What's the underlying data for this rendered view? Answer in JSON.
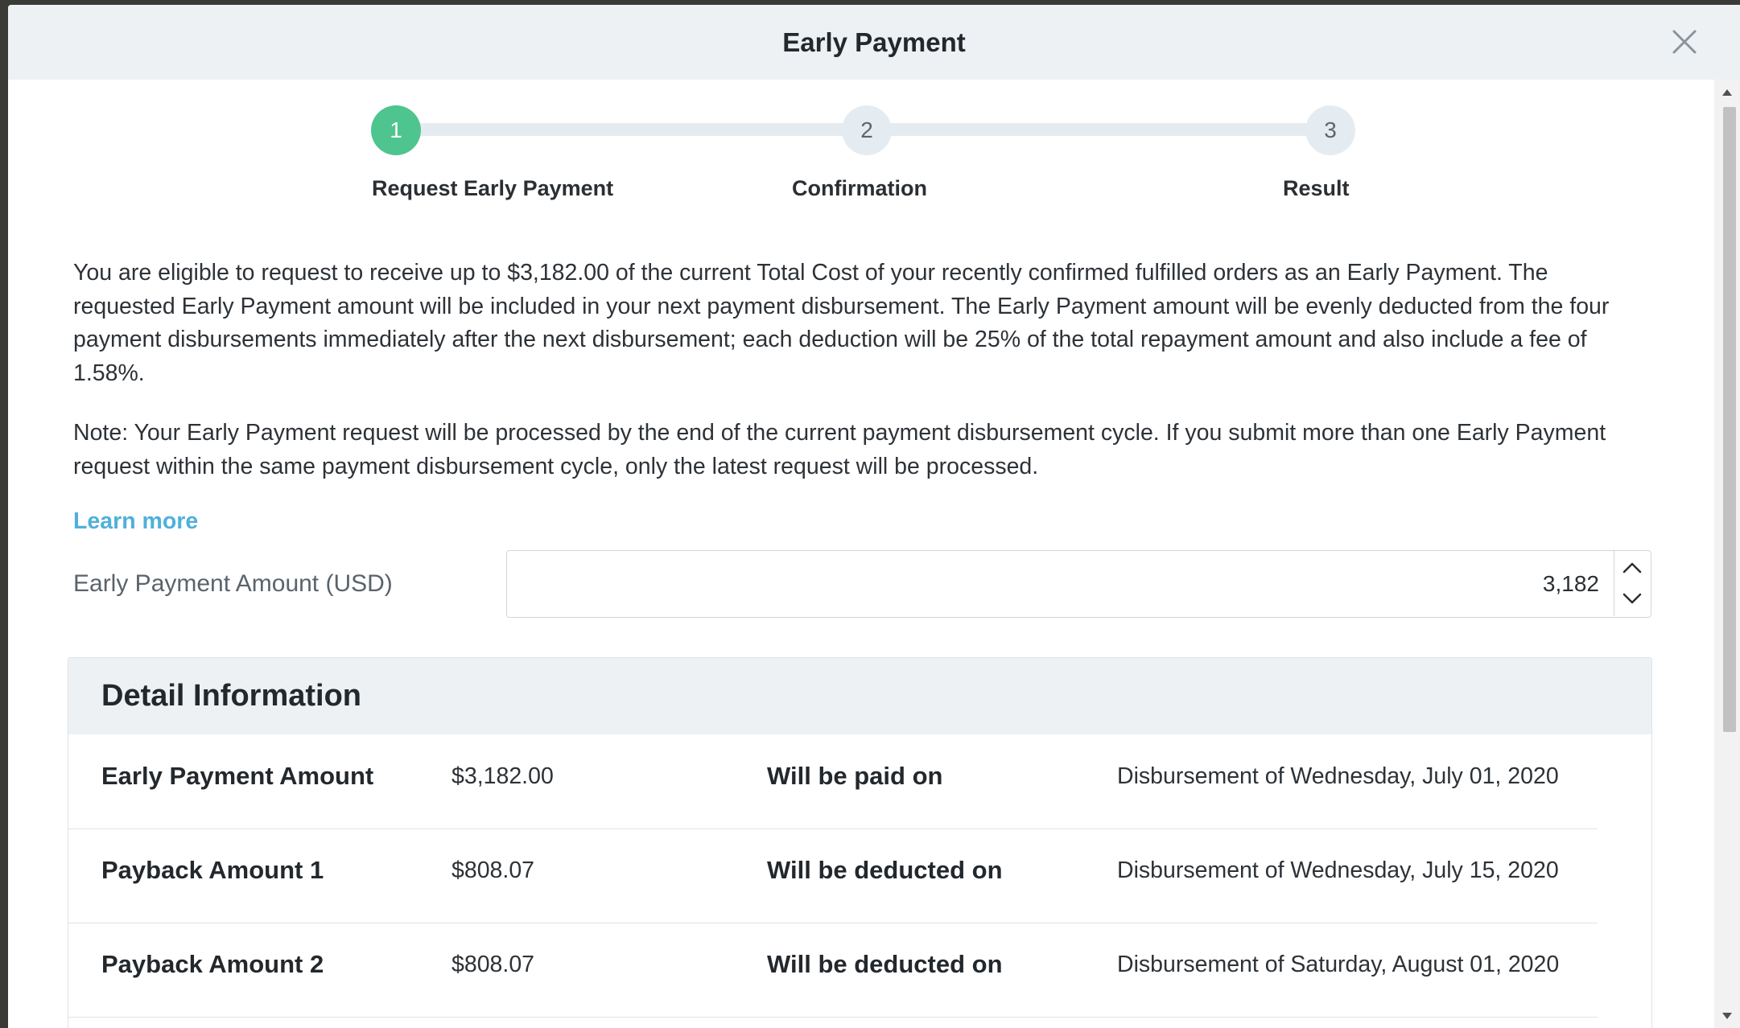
{
  "modal": {
    "title": "Early Payment"
  },
  "stepper": {
    "steps": [
      {
        "number": "1",
        "label": "Request Early Payment",
        "active": true
      },
      {
        "number": "2",
        "label": "Confirmation",
        "active": false
      },
      {
        "number": "3",
        "label": "Result",
        "active": false
      }
    ]
  },
  "intro": {
    "paragraph1": "You are eligible to request to receive up to $3,182.00 of the current Total Cost of your recently confirmed fulfilled orders as an Early Payment. The requested Early Payment amount will be included in your next payment disbursement. The Early Payment amount will be evenly deducted from the four payment disbursements immediately after the next disbursement; each deduction will be 25% of the total repayment amount and also include a fee of 1.58%.",
    "paragraph2": "Note: Your Early Payment request will be processed by the end of the current payment disbursement cycle. If you submit more than one Early Payment request within the same payment disbursement cycle, only the latest request will be processed.",
    "learn_more": "Learn more"
  },
  "amount_field": {
    "label": "Early Payment Amount (USD)",
    "value": "3,182"
  },
  "detail": {
    "title": "Detail Information",
    "rows": [
      {
        "label": "Early Payment Amount",
        "value": "$3,182.00",
        "when_label": "Will be paid on",
        "date": "Disbursement of Wednesday, July 01, 2020"
      },
      {
        "label": "Payback Amount 1",
        "value": "$808.07",
        "when_label": "Will be deducted on",
        "date": "Disbursement of Wednesday, July 15, 2020"
      },
      {
        "label": "Payback Amount 2",
        "value": "$808.07",
        "when_label": "Will be deducted on",
        "date": "Disbursement of Saturday, August 01, 2020"
      }
    ]
  },
  "icons": {
    "close": "close-icon",
    "spin_up": "chevron-up-icon",
    "spin_down": "chevron-down-icon"
  },
  "colors": {
    "accent_green": "#4ec48f",
    "link_blue": "#4fb0db",
    "header_bg": "#edf1f4"
  }
}
